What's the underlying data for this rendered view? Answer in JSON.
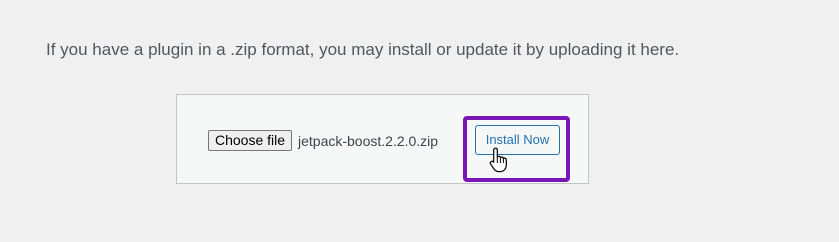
{
  "instructions": "If you have a plugin in a .zip format, you may install or update it by uploading it here.",
  "upload": {
    "choose_file_label": "Choose file",
    "file_name": "jetpack-boost.2.2.0.zip",
    "install_label": "Install Now"
  },
  "colors": {
    "highlight": "#7b16b6",
    "primary": "#2271b1"
  },
  "cursor_icon": "hand-pointer-icon"
}
